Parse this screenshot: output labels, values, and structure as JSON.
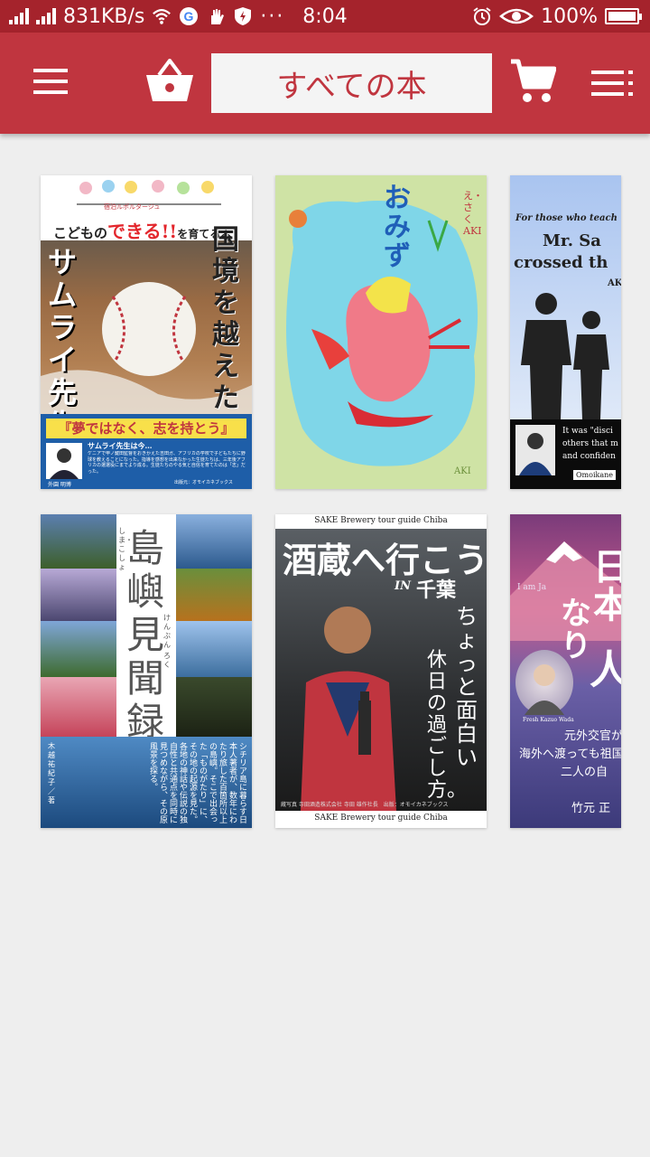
{
  "status_bar": {
    "speed": "831KB/s",
    "dots": "···",
    "time": "8:04",
    "battery": "100%"
  },
  "app_bar": {
    "title": "すべての本"
  },
  "books": [
    {
      "series": "宿泊ルポルタージュ",
      "heading_pre": "こどもの",
      "heading_emph": "できる!!",
      "heading_post": "を育てる本",
      "title_vertical_left": "サムライ先生",
      "title_vertical_right": "国境を越えた",
      "tagline": "『夢ではなく、志を持とう』",
      "blurb_title": "サムライ先生は今…",
      "blurb": "ケニアで甲ノ鍵田監督をおきかえた吉田ガ、アフリカの学校で子どもたちに野球を教えることになった。指導を感想を出来なかった生徒たちは、三年後アフリカの選選役にまでより成る。生徒たちのやる気と自信を育てたのは「志」だった。",
      "author": "外園 明博",
      "publisher": "出版元：オモイカネブックス"
    },
    {
      "title": "おみず",
      "subtitle": "え・さく AKI",
      "signature": "AKI"
    },
    {
      "line1": "For those who teach",
      "line2": "Mr. Sa",
      "line3": "crossed th",
      "abbr": "AK",
      "bottom1": "It was \"disci",
      "bottom2": "others that m",
      "bottom3": "and confiden",
      "publisher": "Omoikane"
    },
    {
      "title_vertical": "島嶼見聞録",
      "reading1": "しま・こしょ",
      "reading2": "けんぶん",
      "reading3": "ろく",
      "author": "木越祐紀子／著",
      "blurb": "シチリア島に暮らす日本人著者が、数年にわたり旅した百箇所以上の島嶼。そこで出会った「ものがたり」に、その地の起源を見た。各地の神話や伝説の独自性と共通点を同時に見つめながら、その原風景を探る。"
    },
    {
      "top_caption": "SAKE Brewery tour guide Chiba",
      "title": "酒蔵へ行こう",
      "sub_in": "IN",
      "sub_place": "千葉",
      "vertical1": "ちょっと面白い",
      "vertical2": "休日の過ごし方。",
      "credits": "蔵写真 寺田酒造株式会社 寺田 雄作社長　出版：オモイカネブックス",
      "bottom_caption": "SAKE Brewery tour guide Chiba"
    },
    {
      "pre": "I am Ja",
      "title_big": "日本",
      "title_nari": "なり",
      "title_hito": "人",
      "photo_caption": "Fresh Kazuo Wada",
      "line1": "元外交官が",
      "line2": "海外へ渡っても祖国",
      "line3": "二人の自",
      "author": "竹元 正"
    }
  ],
  "colors": {
    "status_bar": "#a5232c",
    "app_bar": "#c0353f",
    "background": "#eeeeee"
  }
}
